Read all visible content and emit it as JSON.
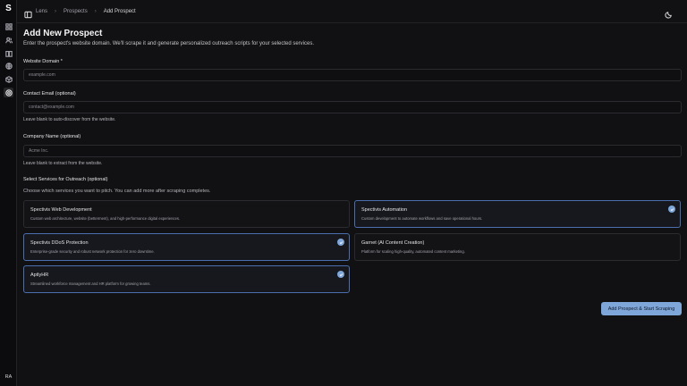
{
  "sidebar": {
    "logo": "S",
    "icons": [
      "dashboard-icon",
      "users-icon",
      "book-icon",
      "globe-icon",
      "package-icon",
      "lens-icon"
    ],
    "avatar_initials": "RA"
  },
  "header": {
    "breadcrumbs": [
      "Lens",
      "Prospects",
      "Add Prospect"
    ]
  },
  "page": {
    "title": "Add New Prospect",
    "subtitle": "Enter the prospect's website domain. We'll scrape it and generate personalized outreach scripts for your selected services."
  },
  "form": {
    "domain": {
      "label": "Website Domain *",
      "placeholder": "example.com",
      "value": ""
    },
    "email": {
      "label": "Contact Email (optional)",
      "placeholder": "contact@example.com",
      "value": "",
      "hint": "Leave blank to auto-discover from the website."
    },
    "company": {
      "label": "Company Name (optional)",
      "placeholder": "Acme Inc.",
      "value": "",
      "hint": "Leave blank to extract from the website."
    },
    "services": {
      "label": "Select Services for Outreach (optional)",
      "hint": "Choose which services you want to pitch. You can add more after scraping completes.",
      "items": [
        {
          "title": "Spectivis Web Development",
          "desc": "Custom web architecture, website (betterment), and high-performance digital experiences.",
          "selected": false
        },
        {
          "title": "Spectivis Automation",
          "desc": "Custom development to automate workflows and save operational hours.",
          "selected": true
        },
        {
          "title": "Spectivis DDoS Protection",
          "desc": "Enterprise-grade security and robust network protection for zero downtime.",
          "selected": true
        },
        {
          "title": "Garnet (AI Content Creation)",
          "desc": "Platform for scaling high-quality, automated content marketing.",
          "selected": false
        },
        {
          "title": "AptlyHR",
          "desc": "Streamlined workforce management and HR platform for growing teams.",
          "selected": true
        }
      ]
    },
    "submit_label": "Add Prospect & Start Scraping"
  },
  "colors": {
    "accent": "#7ea6d8",
    "background": "#111113",
    "selected_border": "#4b6fae"
  }
}
